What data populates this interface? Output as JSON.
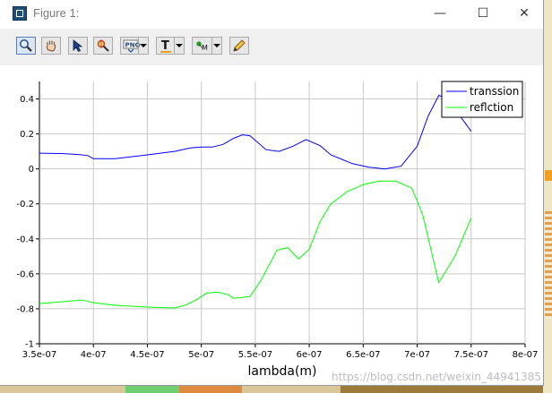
{
  "window": {
    "title": "Figure 1:",
    "minimize_glyph": "—",
    "maximize_glyph": "☐",
    "close_glyph": "✕"
  },
  "toolbar": {
    "tools": [
      {
        "name": "zoom-tool",
        "icon": "magnifier-icon"
      },
      {
        "name": "pan-tool",
        "icon": "hand-icon"
      },
      {
        "name": "select-tool",
        "icon": "arrow-cursor-icon"
      },
      {
        "name": "data-cursor-tool",
        "icon": "data-cursor-icon"
      },
      {
        "name": "save-png-tool",
        "icon": "png-icon",
        "label": "PNG"
      },
      {
        "name": "text-tool",
        "icon": "text-icon",
        "label": "T"
      },
      {
        "name": "marker-tool",
        "icon": "marker-icon",
        "label": "M"
      },
      {
        "name": "edit-tool",
        "icon": "pencil-icon"
      }
    ]
  },
  "watermark": "https://blog.csdn.net/weixin_44941385",
  "chart_data": {
    "type": "line",
    "xlabel": "lambda(m)",
    "ylabel": "",
    "title": "",
    "xlim": [
      3.5e-07,
      8e-07
    ],
    "ylim": [
      -1,
      0.5
    ],
    "grid": true,
    "legend_placement": "top-right",
    "x_ticks": [
      "3.5e-07",
      "4e-07",
      "4.5e-07",
      "5e-07",
      "5.5e-07",
      "6e-07",
      "6.5e-07",
      "7e-07",
      "7.5e-07",
      "8e-07"
    ],
    "y_ticks": [
      "0.4",
      "0.2",
      "0",
      "-0.2",
      "-0.4",
      "-0.6",
      "-0.8",
      "-1"
    ],
    "series": [
      {
        "name": "transsion",
        "color": "#0000ff",
        "points": [
          [
            3.5e-07,
            0.09
          ],
          [
            3.7e-07,
            0.088
          ],
          [
            3.85e-07,
            0.083
          ],
          [
            3.95e-07,
            0.076
          ],
          [
            4e-07,
            0.058
          ],
          [
            4.2e-07,
            0.058
          ],
          [
            4.5e-07,
            0.08
          ],
          [
            4.75e-07,
            0.1
          ],
          [
            4.9e-07,
            0.12
          ],
          [
            5e-07,
            0.125
          ],
          [
            5.1e-07,
            0.125
          ],
          [
            5.2e-07,
            0.14
          ],
          [
            5.3e-07,
            0.175
          ],
          [
            5.38e-07,
            0.195
          ],
          [
            5.45e-07,
            0.19
          ],
          [
            5.6e-07,
            0.11
          ],
          [
            5.72e-07,
            0.1
          ],
          [
            5.85e-07,
            0.13
          ],
          [
            5.97e-07,
            0.168
          ],
          [
            6.1e-07,
            0.133
          ],
          [
            6.2e-07,
            0.08
          ],
          [
            6.4e-07,
            0.03
          ],
          [
            6.55e-07,
            0.01
          ],
          [
            6.7e-07,
            0.0
          ],
          [
            6.85e-07,
            0.015
          ],
          [
            7e-07,
            0.13
          ],
          [
            7.1e-07,
            0.3
          ],
          [
            7.2e-07,
            0.42
          ],
          [
            7.3e-07,
            0.4
          ],
          [
            7.4e-07,
            0.3
          ],
          [
            7.5e-07,
            0.215
          ]
        ]
      },
      {
        "name": "reflction",
        "color": "#00ff00",
        "points": [
          [
            3.5e-07,
            -0.77
          ],
          [
            3.7e-07,
            -0.76
          ],
          [
            3.8e-07,
            -0.755
          ],
          [
            3.9e-07,
            -0.75
          ],
          [
            4e-07,
            -0.765
          ],
          [
            4.2e-07,
            -0.78
          ],
          [
            4.5e-07,
            -0.79
          ],
          [
            4.75e-07,
            -0.795
          ],
          [
            4.85e-07,
            -0.78
          ],
          [
            4.95e-07,
            -0.75
          ],
          [
            5.05e-07,
            -0.71
          ],
          [
            5.15e-07,
            -0.705
          ],
          [
            5.25e-07,
            -0.72
          ],
          [
            5.3e-07,
            -0.74
          ],
          [
            5.45e-07,
            -0.73
          ],
          [
            5.55e-07,
            -0.64
          ],
          [
            5.7e-07,
            -0.465
          ],
          [
            5.8e-07,
            -0.45
          ],
          [
            5.9e-07,
            -0.515
          ],
          [
            6e-07,
            -0.46
          ],
          [
            6.1e-07,
            -0.3
          ],
          [
            6.2e-07,
            -0.2
          ],
          [
            6.35e-07,
            -0.13
          ],
          [
            6.5e-07,
            -0.09
          ],
          [
            6.65e-07,
            -0.07
          ],
          [
            6.8e-07,
            -0.07
          ],
          [
            6.95e-07,
            -0.11
          ],
          [
            7.05e-07,
            -0.26
          ],
          [
            7.2e-07,
            -0.65
          ],
          [
            7.35e-07,
            -0.5
          ],
          [
            7.5e-07,
            -0.28
          ]
        ]
      }
    ]
  }
}
